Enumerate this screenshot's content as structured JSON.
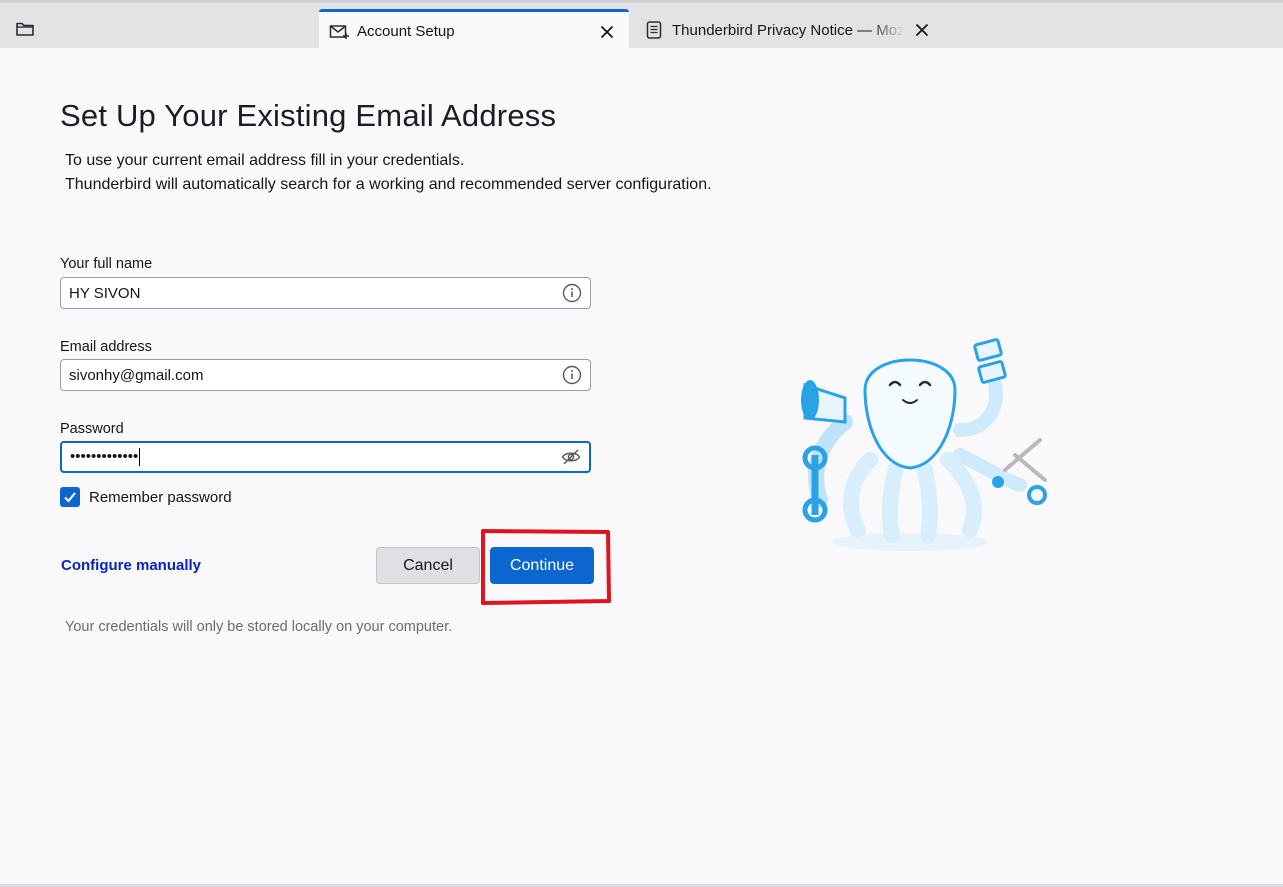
{
  "colors": {
    "accent": "#0b66d0",
    "link": "#0b24b8",
    "highlight": "#e0141e"
  },
  "tabs": [
    {
      "label": "Account Setup",
      "icon": "mail-setup-icon",
      "active": true
    },
    {
      "label": "Thunderbird Privacy Notice — Mozilla",
      "icon": "document-icon",
      "active": false
    }
  ],
  "page": {
    "title": "Set Up Your Existing Email Address",
    "intro_line1": "To use your current email address fill in your credentials.",
    "intro_line2": "Thunderbird will automatically search for a working and recommended server configuration."
  },
  "form": {
    "fullname_label": "Your full name",
    "fullname_value": "HY SIVON",
    "email_label": "Email address",
    "email_value": "sivonhy@gmail.com",
    "password_label": "Password",
    "password_value": "•••••••••••••",
    "remember_label": "Remember password",
    "remember_checked": true
  },
  "actions": {
    "configure_manually": "Configure manually",
    "cancel": "Cancel",
    "continue": "Continue"
  },
  "footer_note": "Your credentials will only be stored locally on your computer."
}
